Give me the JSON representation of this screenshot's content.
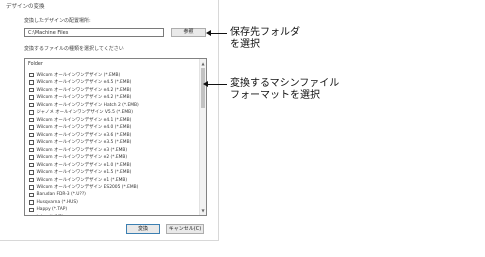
{
  "dialog": {
    "title": "デザインの変換",
    "folder_label": "変換したデザインの配置場所:",
    "folder_value": "C:\\Machine Files",
    "browse_label": "参照",
    "types_label": "変換するファイルの種類を選択してください",
    "list_header": "Folder",
    "items": [
      "Wilcom オールインワンデザイン (*.EMB)",
      "Wilcom オールインワンデザイン e4.5 (*.EMB)",
      "Wilcom オールインワンデザイン e4.2 (*.EMB)",
      "Wilcom オールインワンデザイン e4.2 (*.EMB)",
      "Wilcom オールインワンデザイン Hatch 2 (*.EMB)",
      "ジャノメ オールインワンデザイン V5.5 (*.EMB)",
      "Wilcom オールインワンデザイン e4.1 (*.EMB)",
      "Wilcom オールインワンデザイン e4.0 (*.EMB)",
      "Wilcom オールインワンデザイン e3.6 (*.EMB)",
      "Wilcom オールインワンデザイン e3.5 (*.EMB)",
      "Wilcom オールインワンデザイン e3 (*.EMB)",
      "Wilcom オールインワンデザイン e2 (*.EMB)",
      "Wilcom オールインワンデザイン e1.0 (*.EMB)",
      "Wilcom オールインワンデザイン e1.5 (*.EMB)",
      "Wilcom オールインワンデザイン e1 (*.EMB)",
      "Wilcom オールインワンデザイン ES2005 (*.EMB)",
      "Barudan FDR-3 (*.U??)",
      "Husqvarna (*.HUS)",
      "Happy (*.TAP)",
      "Inbro (*.INB)"
    ],
    "ok_label": "変換",
    "cancel_label": "キャンセル(C)"
  },
  "annotations": {
    "save_folder_line1": "保存先フォルダ",
    "save_folder_line2": "を選択",
    "format_line1": "変換するマシンファイル",
    "format_line2": "フォーマットを選択"
  }
}
